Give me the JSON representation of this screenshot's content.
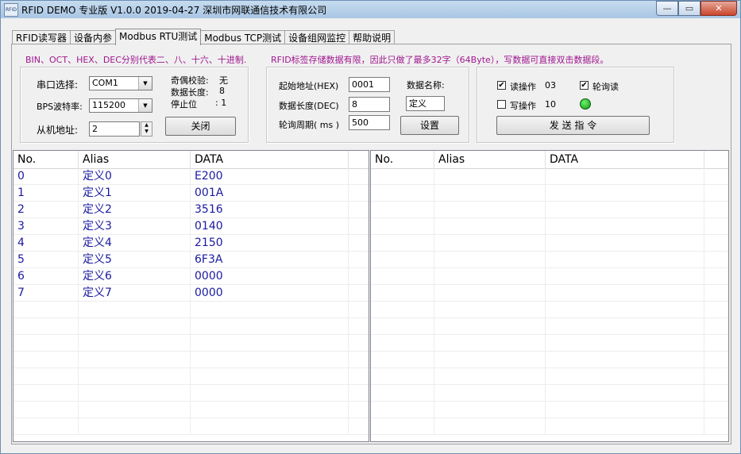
{
  "window": {
    "title": "RFID DEMO 专业版 V1.0.0  2019-04-27 深圳市网联通信技术有限公司",
    "min_label": "—",
    "max_label": "▭",
    "close_label": "✕"
  },
  "tabs": [
    {
      "label": "RFID读写器"
    },
    {
      "label": "设备内参"
    },
    {
      "label": "Modbus RTU测试"
    },
    {
      "label": "Modbus TCP测试"
    },
    {
      "label": "设备组网监控"
    },
    {
      "label": "帮助说明"
    }
  ],
  "notice": {
    "left": "BIN、OCT、HEX、DEC分别代表二、八、十六、十进制.",
    "right": "RFID标签存储数据有限，因此只做了最多32字（64Byte），写数据可直接双击数据段。"
  },
  "serial": {
    "port_label": "串口选择:",
    "port_value": "COM1",
    "baud_label": "BPS波特率:",
    "baud_value": "115200",
    "slave_label": "从机地址:",
    "slave_value": "2",
    "parity_label": "奇偶校验:",
    "parity_value": "无",
    "databits_label": "数据长度:",
    "databits_value": "8",
    "stopbits_label": "停止位",
    "stopbits_value": ": 1",
    "close_button": "关闭"
  },
  "params": {
    "start_label": "起始地址(HEX)",
    "start_value": "0001",
    "length_label": "数据长度(DEC)",
    "length_value": "8",
    "period_label": "轮询周期( ms )",
    "period_value": "500",
    "name_label": "数据名称:",
    "name_value": "定义",
    "set_button": "设置"
  },
  "ops": {
    "read_label": "读操作",
    "read_code": "03",
    "read_checked": "✔",
    "write_label": "写操作",
    "write_code": "10",
    "write_checked": "",
    "poll_label": "轮询读",
    "poll_checked": "✔",
    "send_button": "发  送  指  令",
    "led_color": "#18b21e"
  },
  "left_table": {
    "headers": [
      "No.",
      "Alias",
      "DATA",
      ""
    ],
    "rows": [
      [
        "0",
        "定义0",
        "E200"
      ],
      [
        "1",
        "定义1",
        "001A"
      ],
      [
        "2",
        "定义2",
        "3516"
      ],
      [
        "3",
        "定义3",
        "0140"
      ],
      [
        "4",
        "定义4",
        "2150"
      ],
      [
        "5",
        "定义5",
        "6F3A"
      ],
      [
        "6",
        "定义6",
        "0000"
      ],
      [
        "7",
        "定义7",
        "0000"
      ]
    ]
  },
  "right_table": {
    "headers": [
      "No.",
      "Alias",
      "DATA",
      ""
    ],
    "rows": []
  }
}
